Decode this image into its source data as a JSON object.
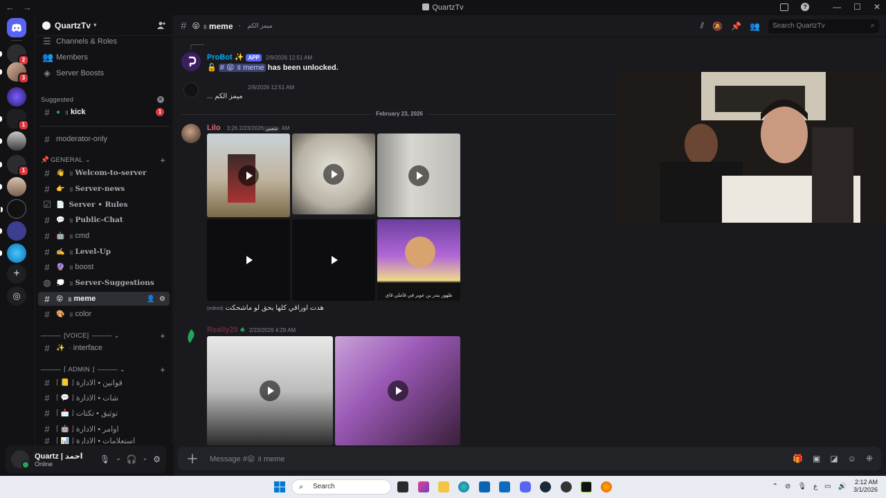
{
  "titlebar": {
    "title": "QuartzTv"
  },
  "server": {
    "name": "QuartzTv"
  },
  "sidebar": {
    "channels_roles": "Channels & Roles",
    "members": "Members",
    "server_boosts": "Server Boosts",
    "suggested_label": "Suggested",
    "kick": "kick",
    "kick_badge": "1",
    "moderator_only": "moderator-only",
    "cat_general": "GENERAL",
    "channels": [
      {
        "emoji": "👋",
        "label": "Welcom-to-server"
      },
      {
        "emoji": "👉",
        "label": "Server-news"
      },
      {
        "emoji": "📄",
        "label": "Server • Rules"
      },
      {
        "emoji": "💬",
        "label": "Public-Chat"
      },
      {
        "emoji": "🤖",
        "label": "cmd"
      },
      {
        "emoji": "✍️",
        "label": "Level-Up"
      },
      {
        "emoji": "🔮",
        "label": "boost"
      },
      {
        "emoji": "💭",
        "label": "Server-Suggestions"
      },
      {
        "emoji": "😝",
        "label": "meme"
      },
      {
        "emoji": "🎨",
        "label": "color"
      }
    ],
    "cat_voice": "[VOICE]",
    "interface": "interface",
    "cat_admin": "⌈ ADMIN ⌋",
    "admin_channels": [
      {
        "label": "قوانين • الادارة"
      },
      {
        "label": "شات • الادارة"
      },
      {
        "label": "توثيق • تكتات"
      },
      {
        "label": "اوامر • الادارة"
      },
      {
        "label": "استعلامات • الادارة"
      }
    ]
  },
  "user": {
    "name": "Quartz | احمد",
    "status": "Online"
  },
  "rail": {
    "badges": [
      "2",
      "3",
      "1",
      "1"
    ]
  },
  "chat": {
    "channel": "meme",
    "topic": "ميمز الكم",
    "search_placeholder": "Search QuartzTv",
    "compose_placeholder": "Message #😝 ॥ meme",
    "date_divider": "February 23, 2026",
    "messages": [
      {
        "author": "ProBot",
        "tag": "APP",
        "time": "2/9/2026 12:51 AM",
        "text_channel": "meme",
        "text_suffix": "has been unlocked."
      },
      {
        "author": "",
        "time": "2/9/2026 12:51 AM",
        "text": "... ميمز الكم"
      },
      {
        "author": "Lilo",
        "role_tag": "شعبي",
        "time": "2/23/2026 3:26 AM",
        "caption": "هدت اوراقي كلها بحق لو ماشحكت",
        "edited": "(edited)",
        "tile_caption": "ظهور بندر بن عوير في قاملي قاي"
      },
      {
        "author": "Really25",
        "time": "2/23/2026 4:29 AM"
      }
    ]
  },
  "taskbar": {
    "search": "Search",
    "time": "2:12 AM",
    "date": "3/1/2026"
  }
}
